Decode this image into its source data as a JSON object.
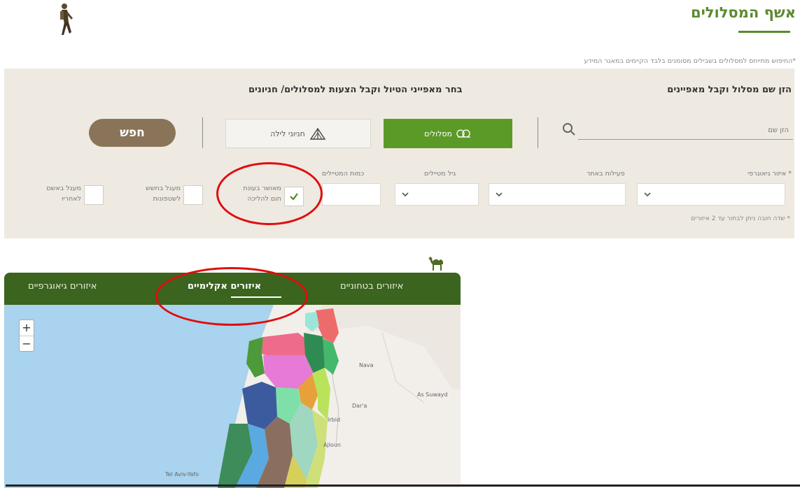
{
  "header": {
    "title": "אשף המסלולים",
    "subtitle": "*החיפוש מתייחס למסלולים בשבילים מסומנים בלבד הקיימים במאגר המידע"
  },
  "panel": {
    "route_name_heading": "הזן שם מסלול וקבל מאפיינים",
    "features_heading": "בחר מאפייני הטיול וקבל הצעות למסלולים/ חניונים",
    "search_placeholder": "הזן שם",
    "routes_button": "מסלולים",
    "camps_button": "חניוני לילה",
    "search_button": "חפש",
    "filters": {
      "geo_region_label": "* איזור גיאוגרפי",
      "activity_label": "פעילות באתר",
      "age_label": "גיל מטיילים",
      "count_label": "כמות המטיילים"
    },
    "checkboxes": [
      {
        "label_line1": "מאושר בעונת",
        "label_line2": "חום להליכה",
        "checked": true
      },
      {
        "label_line1": "מעגל בחשש",
        "label_line2": "לשטפונות",
        "checked": false
      },
      {
        "label_line1": "מעגל באשם",
        "label_line2": "לאחריו",
        "checked": false
      }
    ],
    "note": "* שדה חובה ניתן לבחור עד 2 איזורים"
  },
  "map": {
    "tabs": [
      {
        "label": "איזורים בטחוניים",
        "active": false
      },
      {
        "label": "איזורים אקלימיים",
        "active": true
      },
      {
        "label": "איזורים גיאוגרפיים",
        "active": false
      }
    ],
    "zoom_in": "+",
    "zoom_out": "−",
    "places": [
      "Nava",
      "Dar'a",
      "As Suwayd",
      "Irbid",
      "Ajloun",
      "Tel Aviv-Yafo"
    ]
  },
  "colors": {
    "brand_green": "#5b8a2f",
    "tab_bar": "#3b641e",
    "search_button": "#8a7459",
    "panel_bg": "#eeeae2",
    "annotation_red": "#e00d0d"
  }
}
